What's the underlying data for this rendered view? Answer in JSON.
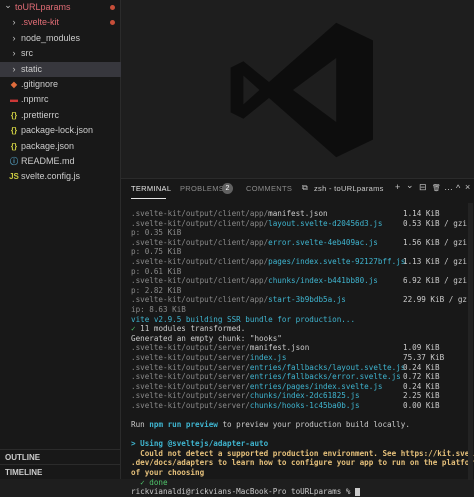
{
  "explorer": {
    "items": [
      {
        "label": "toURLparams",
        "kind": "folder-open",
        "color": "#e06c75"
      },
      {
        "label": ".svelte-kit",
        "kind": "folder",
        "color": "#e06c75"
      },
      {
        "label": "node_modules",
        "kind": "folder",
        "color": "#cccccc"
      },
      {
        "label": "src",
        "kind": "folder",
        "color": "#cccccc"
      },
      {
        "label": "static",
        "kind": "folder",
        "color": "#cccccc"
      },
      {
        "label": ".gitignore",
        "kind": "file",
        "icon": "git-icon",
        "color": "#cccccc"
      },
      {
        "label": ".npmrc",
        "kind": "file",
        "icon": "npm-icon",
        "color": "#cccccc"
      },
      {
        "label": ".prettierrc",
        "kind": "file",
        "icon": "braces-icon",
        "color": "#cccccc"
      },
      {
        "label": "package-lock.json",
        "kind": "file",
        "icon": "braces-icon",
        "color": "#cccccc"
      },
      {
        "label": "package.json",
        "kind": "file",
        "icon": "braces-icon",
        "color": "#cccccc"
      },
      {
        "label": "README.md",
        "kind": "file",
        "icon": "info-icon",
        "color": "#cccccc"
      },
      {
        "label": "svelte.config.js",
        "kind": "file",
        "icon": "js-icon",
        "color": "#cccccc"
      }
    ],
    "outline": "OUTLINE",
    "timeline": "TIMELINE"
  },
  "panel": {
    "tabs": {
      "terminal": "TERMINAL",
      "problems": "PROBLEMS",
      "problems_count": "2",
      "comments": "COMMENTS"
    },
    "terminal_name": "zsh - toURLparams",
    "controls": {
      "plus": "+",
      "chevron": "⌄",
      "split": "⊟",
      "trash": "🗑",
      "more": "…",
      "maximize": "^",
      "close": "×"
    }
  },
  "terminal": {
    "lines": [
      {
        "parts": [
          [
            ".svelte-kit/output/client/app/",
            "g"
          ],
          [
            "manifest.json",
            ""
          ]
        ],
        "size": "1.14 KiB"
      },
      {
        "parts": [
          [
            ".svelte-kit/output/client/app/",
            "g"
          ],
          [
            "layout.svelte-d20456d3.js",
            "c"
          ]
        ],
        "size": "0.53 KiB / gzi"
      },
      {
        "parts": [
          [
            "p: 0.35 KiB",
            "g"
          ]
        ]
      },
      {
        "parts": [
          [
            ".svelte-kit/output/client/app/",
            "g"
          ],
          [
            "error.svelte-4eb409ac.js",
            "c"
          ]
        ],
        "size": "1.56 KiB / gzi"
      },
      {
        "parts": [
          [
            "p: 0.75 KiB",
            "g"
          ]
        ]
      },
      {
        "parts": [
          [
            ".svelte-kit/output/client/app/",
            "g"
          ],
          [
            "pages/index.svelte-92127bff.js",
            "c"
          ]
        ],
        "size": "1.13 KiB / gzi"
      },
      {
        "parts": [
          [
            "p: 0.61 KiB",
            "g"
          ]
        ]
      },
      {
        "parts": [
          [
            ".svelte-kit/output/client/app/",
            "g"
          ],
          [
            "chunks/index-b441bb80.js",
            "c"
          ]
        ],
        "size": "6.92 KiB / gzi"
      },
      {
        "parts": [
          [
            "p: 2.82 KiB",
            "g"
          ]
        ]
      },
      {
        "parts": [
          [
            ".svelte-kit/output/client/app/",
            "g"
          ],
          [
            "start-3b9bdb5a.js",
            "c"
          ]
        ],
        "size": "22.99 KiB / gz"
      },
      {
        "parts": [
          [
            "ip: 8.63 KiB",
            "g"
          ]
        ]
      },
      {
        "parts": [
          [
            "vite v2.9.5 building SSR bundle for production...",
            "c"
          ]
        ]
      },
      {
        "parts": [
          [
            "✓ ",
            "gr"
          ],
          [
            "11 modules transformed.",
            ""
          ]
        ]
      },
      {
        "parts": [
          [
            "Generated an empty chunk: \"hooks\"",
            ""
          ]
        ]
      },
      {
        "parts": [
          [
            ".svelte-kit/output/server/",
            "g"
          ],
          [
            "manifest.json",
            ""
          ]
        ],
        "size": "1.09 KiB"
      },
      {
        "parts": [
          [
            ".svelte-kit/output/server/",
            "g"
          ],
          [
            "index.js",
            "c"
          ]
        ],
        "size": "75.37 KiB"
      },
      {
        "parts": [
          [
            ".svelte-kit/output/server/",
            "g"
          ],
          [
            "entries/fallbacks/layout.svelte.js",
            "c"
          ]
        ],
        "size": "0.24 KiB"
      },
      {
        "parts": [
          [
            ".svelte-kit/output/server/",
            "g"
          ],
          [
            "entries/fallbacks/error.svelte.js",
            "c"
          ]
        ],
        "size": "0.72 KiB"
      },
      {
        "parts": [
          [
            ".svelte-kit/output/server/",
            "g"
          ],
          [
            "entries/pages/index.svelte.js",
            "c"
          ]
        ],
        "size": "0.24 KiB"
      },
      {
        "parts": [
          [
            ".svelte-kit/output/server/",
            "g"
          ],
          [
            "chunks/index-2dc61825.js",
            "c"
          ]
        ],
        "size": "2.25 KiB"
      },
      {
        "parts": [
          [
            ".svelte-kit/output/server/",
            "g"
          ],
          [
            "chunks/hooks-1c45ba0b.js",
            "c"
          ]
        ],
        "size": "0.00 KiB"
      },
      {
        "parts": [
          [
            "",
            ""
          ]
        ]
      },
      {
        "parts": [
          [
            "Run ",
            ""
          ],
          [
            "npm run preview",
            "c b"
          ],
          [
            " to preview your production build locally.",
            ""
          ]
        ]
      },
      {
        "parts": [
          [
            "",
            ""
          ]
        ]
      },
      {
        "parts": [
          [
            "> Using @sveltejs/adapter-auto",
            "c b"
          ]
        ]
      },
      {
        "parts": [
          [
            "  Could not detect a supported production environment. See https://kit.svelte",
            "y b"
          ]
        ]
      },
      {
        "parts": [
          [
            ".dev/docs/adapters to learn how to configure your app to run on the platform",
            "y b"
          ]
        ]
      },
      {
        "parts": [
          [
            "of your choosing",
            "y b"
          ]
        ]
      },
      {
        "parts": [
          [
            "  ✓ done",
            "gr"
          ]
        ]
      },
      {
        "parts": [
          [
            "rickvianaldi@rickvians-MacBook-Pro toURLparams % ",
            ""
          ]
        ],
        "cursor": true
      }
    ]
  }
}
